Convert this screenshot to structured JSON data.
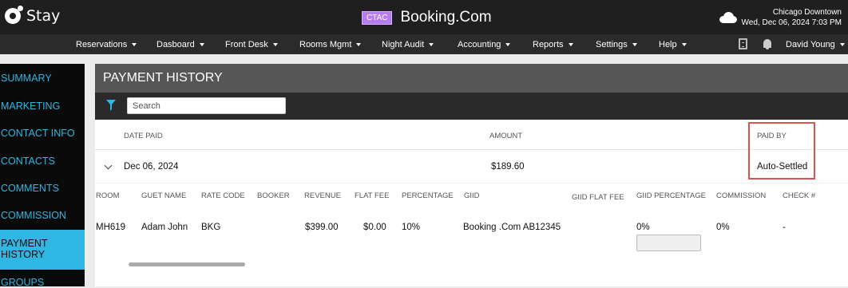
{
  "app": {
    "brand": "Stay",
    "env_badge": "CTAC",
    "title": "Booking.Com"
  },
  "location": {
    "name": "Chicago Downtown",
    "datetime": "Wed, Dec 06, 2024 7:03 PM"
  },
  "nav": {
    "items": [
      "Reservations",
      "Dasboard",
      "Front Desk",
      "Rooms Mgmt",
      "Night Audit",
      "Accounting",
      "Reports",
      "Settings",
      "Help"
    ],
    "user": "David Young"
  },
  "sidebar": {
    "items": [
      {
        "label": "SUMMARY"
      },
      {
        "label": "MARKETING"
      },
      {
        "label": "CONTACT INFO"
      },
      {
        "label": "CONTACTS"
      },
      {
        "label": "COMMENTS"
      },
      {
        "label": "COMMISSION"
      },
      {
        "label": "PAYMENT",
        "label2": "HISTORY",
        "active": true
      },
      {
        "label": "GROUPS"
      }
    ]
  },
  "panel": {
    "title": "PAYMENT HISTORY",
    "search_placeholder": "Search",
    "columns": {
      "date_paid": "DATE PAID",
      "amount": "AMOUNT",
      "paid_by": "PAID BY"
    },
    "summary": {
      "date": "Dec 06, 2024",
      "amount": "$189.60",
      "paid_by": "Auto-Settled"
    },
    "detail_columns": [
      "ROOM",
      "GUET NAME",
      "RATE CODE",
      "BOOKER",
      "REVENUE",
      "FLAT FEE",
      "PERCENTAGE",
      "GIID",
      "GIID FLAT FEE",
      "GIID PERCENTAGE",
      "COMMISSION",
      "CHECK #"
    ],
    "detail_row": {
      "room": "MH619",
      "guest": "Adam John",
      "rate_code": "BKG",
      "booker": "",
      "revenue": "$399.00",
      "flat_fee": "$0.00",
      "percentage": "10%",
      "giid": "Booking .Com AB12345",
      "giid_flat_fee": "",
      "giid_percentage": "0%",
      "commission": "0%",
      "check": "-"
    }
  },
  "colors": {
    "accent": "#2fb6e3",
    "topbar": "#1f1f1f",
    "highlight": "#d9534f",
    "badge": "#b97cf0"
  }
}
